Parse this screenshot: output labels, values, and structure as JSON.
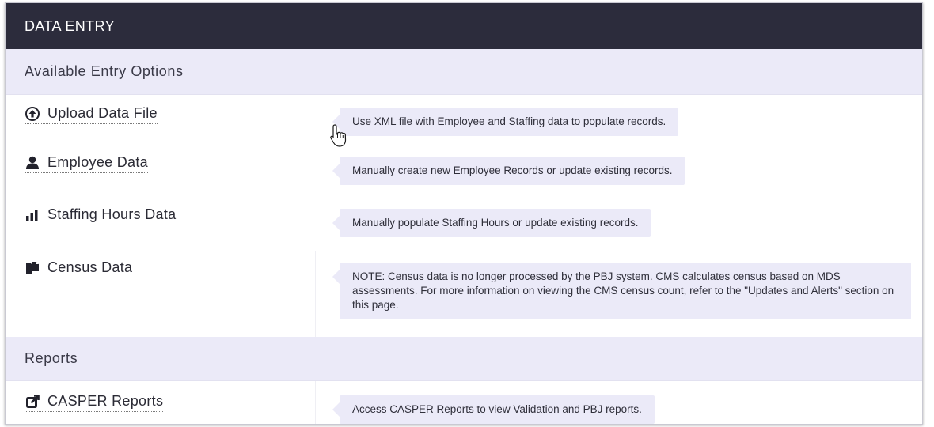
{
  "panel": {
    "title": "DATA ENTRY"
  },
  "entry_options": {
    "heading": "Available Entry Options",
    "items": [
      {
        "icon": "upload-circle-icon",
        "label": "Upload Data File",
        "description": "Use XML file with Employee and Staffing data to populate records."
      },
      {
        "icon": "user-icon",
        "label": "Employee Data",
        "description": "Manually create new Employee Records or update existing records."
      },
      {
        "icon": "bar-chart-icon",
        "label": "Staffing Hours Data",
        "description": "Manually populate Staffing Hours or update existing records."
      },
      {
        "icon": "copy-documents-icon",
        "label": "Census Data",
        "description": "NOTE: Census data is no longer processed by the PBJ system. CMS calculates census based on MDS assessments. For more information on viewing the CMS census count, refer to the \"Updates and Alerts\" section on this page."
      }
    ]
  },
  "reports": {
    "heading": "Reports",
    "items": [
      {
        "icon": "external-link-icon",
        "label": "CASPER Reports",
        "description": "Access CASPER Reports to view Validation and PBJ reports."
      }
    ]
  },
  "colors": {
    "header_bg": "#2c2c3c",
    "section_bg": "#ebeaf8",
    "tooltip_bg": "#ebeaf8"
  }
}
